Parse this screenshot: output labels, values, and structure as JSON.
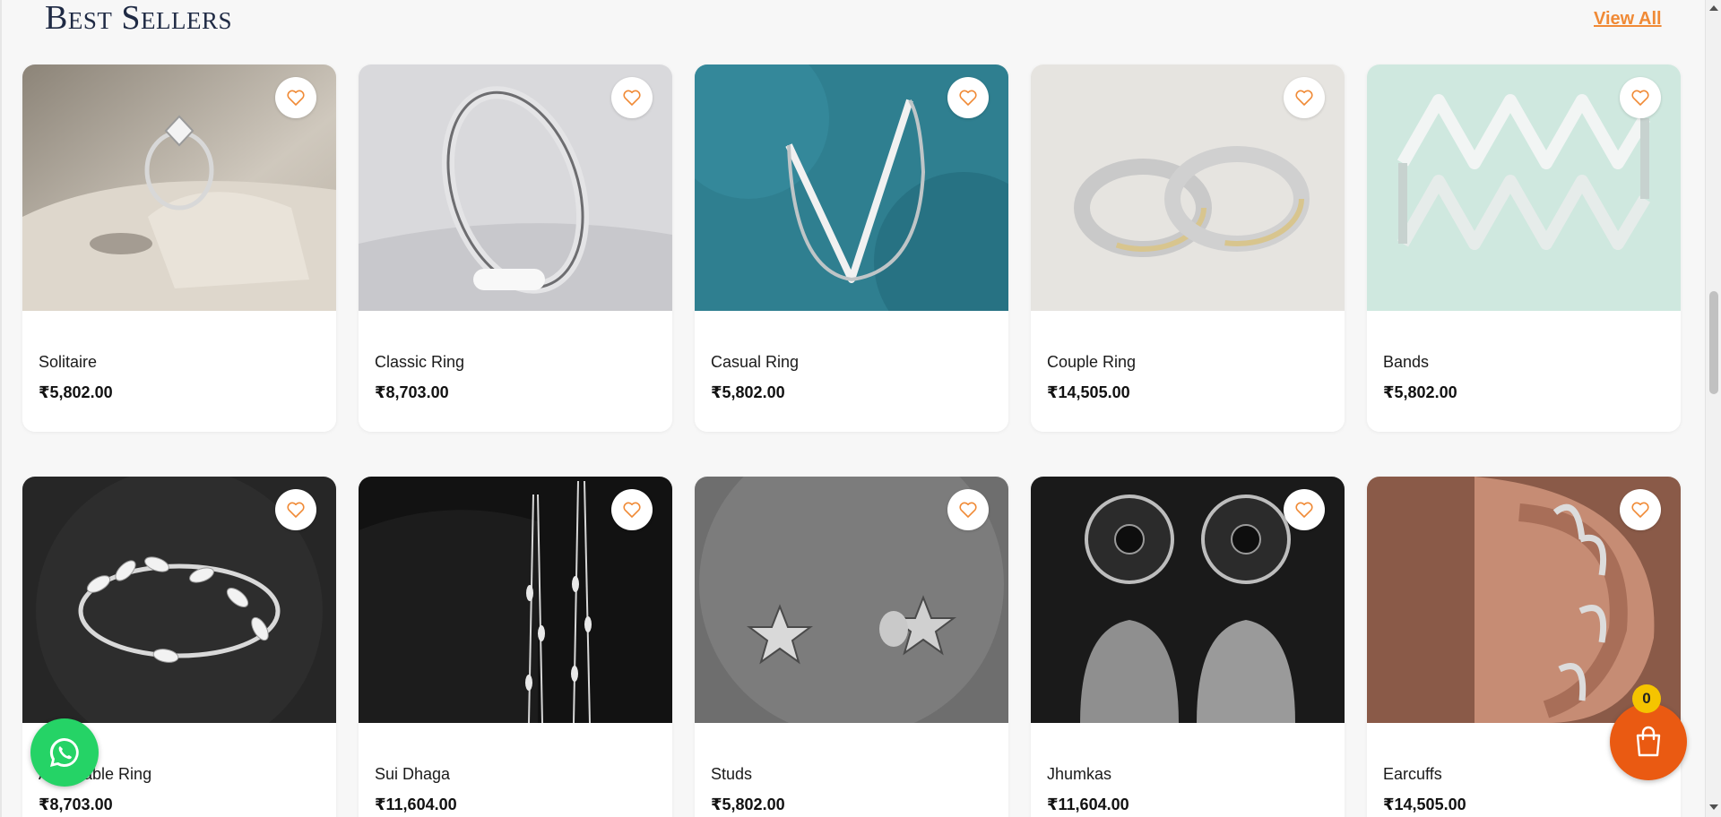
{
  "section": {
    "title": "Best Sellers",
    "view_all": "View All"
  },
  "colors": {
    "accent": "#f08a36",
    "cart": "#ea5a12",
    "badge": "#f5c400",
    "whatsapp": "#25d366"
  },
  "products": [
    {
      "name": "Solitaire",
      "price": "₹5,802.00",
      "image": "solitaire-ring"
    },
    {
      "name": "Classic Ring",
      "price": "₹8,703.00",
      "image": "plain-silver-band"
    },
    {
      "name": "Casual Ring",
      "price": "₹5,802.00",
      "image": "v-shaped-ring"
    },
    {
      "name": "Couple Ring",
      "price": "₹14,505.00",
      "image": "two-rings"
    },
    {
      "name": "Bands",
      "price": "₹5,802.00",
      "image": "zigzag-band"
    },
    {
      "name": "Adjustable Ring",
      "price": "₹8,703.00",
      "image": "leaf-ring"
    },
    {
      "name": "Sui Dhaga",
      "price": "₹11,604.00",
      "image": "drop-earrings"
    },
    {
      "name": "Studs",
      "price": "₹5,802.00",
      "image": "star-studs"
    },
    {
      "name": "Jhumkas",
      "price": "₹11,604.00",
      "image": "jhumka-earrings"
    },
    {
      "name": "Earcuffs",
      "price": "₹14,505.00",
      "image": "ear-cuffs"
    }
  ],
  "cart": {
    "count": "0"
  }
}
